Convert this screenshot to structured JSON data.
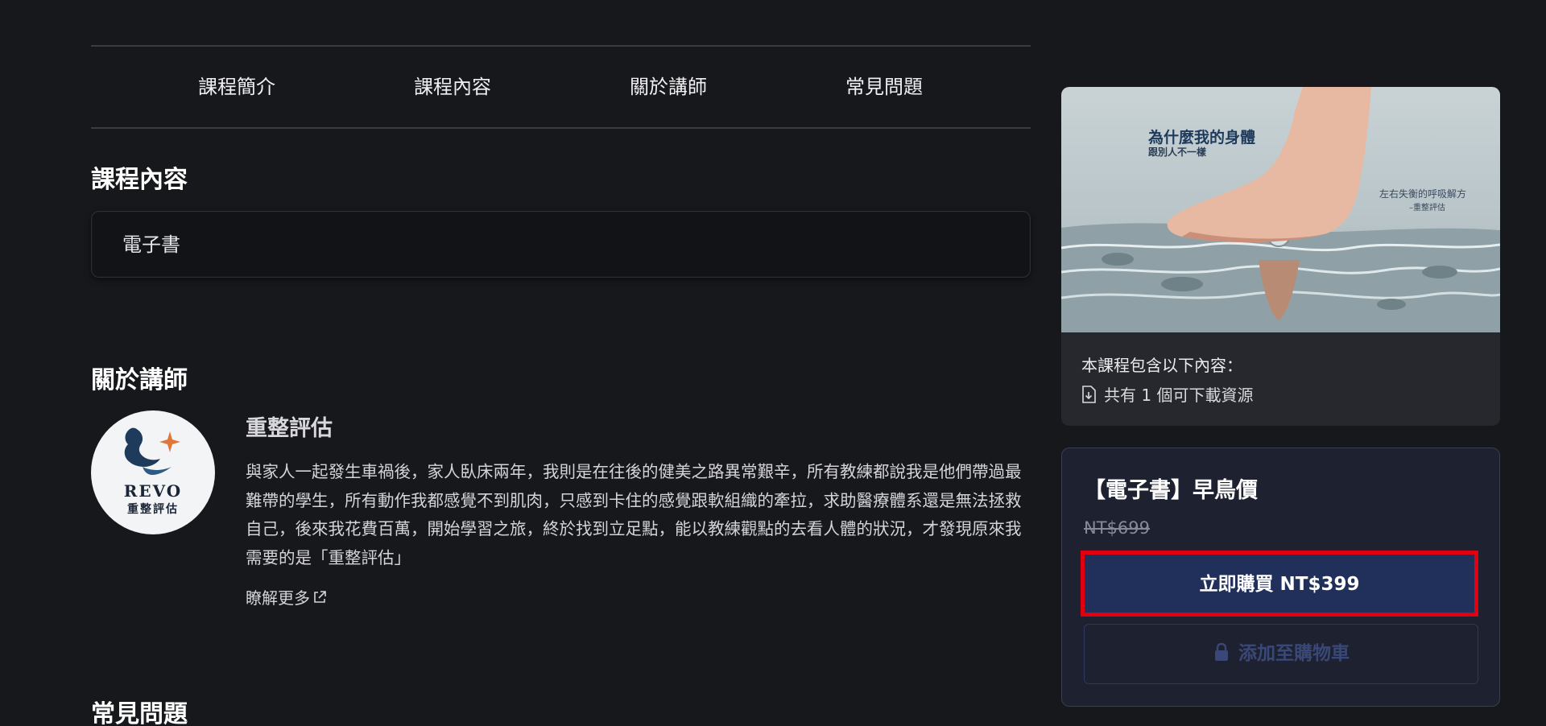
{
  "nav": {
    "tabs": [
      {
        "label": "課程簡介"
      },
      {
        "label": "課程內容"
      },
      {
        "label": "關於講師"
      },
      {
        "label": "常見問題"
      }
    ]
  },
  "content_section": {
    "heading": "課程內容",
    "items": [
      {
        "label": "電子書"
      }
    ]
  },
  "instructor_section": {
    "heading": "關於講師",
    "name": "重整評估",
    "avatar_brand": "REVO",
    "avatar_brand_zh": "重整評估",
    "bio": "與家人一起發生車禍後，家人臥床兩年，我則是在往後的健美之路異常艱辛，所有教練都說我是他們帶過最難帶的學生，所有動作我都感覺不到肌肉，只感到卡住的感覺跟軟組織的牽拉，求助醫療體系還是無法拯救自己，後來我花費百萬，開始學習之旅，終於找到立足點，能以教練觀點的去看人體的狀況，才發現原來我需要的是「重整評估」",
    "learn_more": "瞭解更多"
  },
  "faq_section": {
    "heading": "常見問題"
  },
  "course_card": {
    "cover": {
      "title": "為什麼我的身體",
      "subtitle": "跟別人不一樣",
      "side_text": "左右失衡的呼吸解方",
      "side_author": "–重整評估"
    },
    "includes_label": "本課程包含以下內容：",
    "includes_item": "共有 1 個可下載資源"
  },
  "purchase": {
    "plan_title": "【電子書】早鳥價",
    "original_price": "NT$699",
    "buy_label": "立即購買 NT$399",
    "cart_label": "添加至購物車"
  },
  "colors": {
    "background": "#17181c",
    "buy_button": "#21305a",
    "highlight_border": "#e0000f",
    "brand_navy": "#1f3b5c",
    "star_orange": "#e0773a"
  }
}
